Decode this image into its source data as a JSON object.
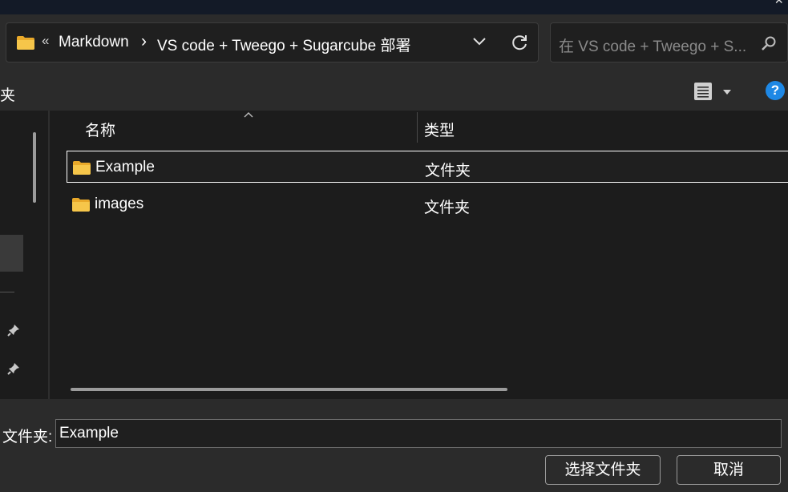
{
  "titlebar": {
    "close_glyph": "×"
  },
  "address": {
    "overflow_glyph": "«",
    "crumbs": [
      "Markdown",
      "VS code + Tweego + Sugarcube 部署"
    ],
    "separator": "›"
  },
  "search": {
    "placeholder": "在 VS code + Tweego + S..."
  },
  "commandbar": {
    "partial_label": "夹",
    "help_glyph": "?"
  },
  "columns": {
    "name": "名称",
    "type": "类型"
  },
  "files": [
    {
      "name": "Example",
      "type": "文件夹",
      "selected": true
    },
    {
      "name": "images",
      "type": "文件夹",
      "selected": false
    }
  ],
  "footer": {
    "folder_label": "文件夹:",
    "folder_value": "Example",
    "ok_label": "选择文件夹",
    "cancel_label": "取消"
  },
  "colors": {
    "accent": "#1e88e5",
    "folder": "#f6c64a",
    "background": "#1c1c1c",
    "panel": "#2b2b2b"
  },
  "icons": [
    "folder-icon",
    "chevron-down-icon",
    "refresh-icon",
    "search-icon",
    "view-options-icon",
    "help-icon",
    "pin-icon",
    "sort-caret-icon",
    "close-icon"
  ]
}
